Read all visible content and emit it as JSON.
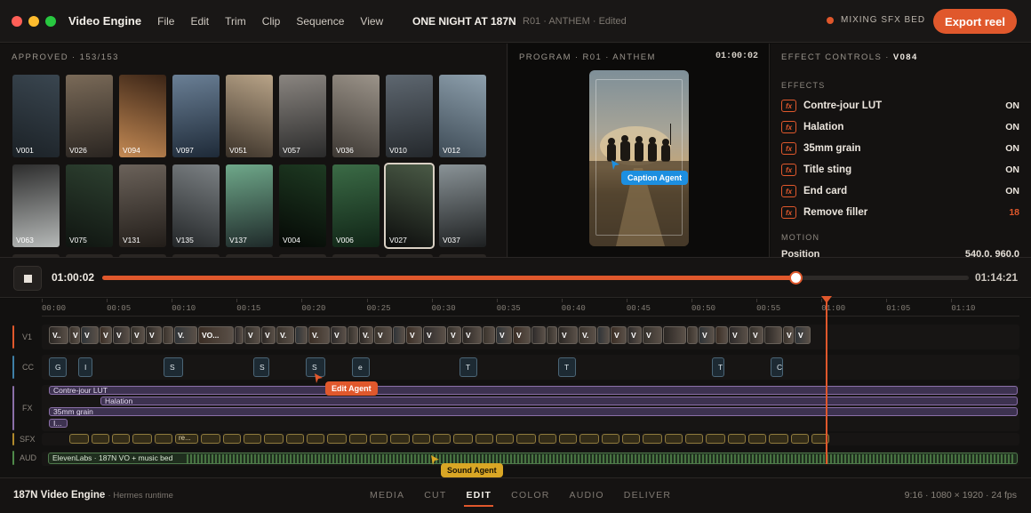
{
  "window": {
    "app_name": "Video Engine",
    "menu": [
      "File",
      "Edit",
      "Trim",
      "Clip",
      "Sequence",
      "View"
    ],
    "project_title": "ONE NIGHT AT 187N",
    "project_subtitle": "R01 · ANTHEM · Edited",
    "status": "MIXING SFX BED",
    "export_label": "Export reel"
  },
  "media": {
    "header": "APPROVED · 153/153",
    "thumbs": [
      "V001",
      "V026",
      "V094",
      "V097",
      "V051",
      "V057",
      "V036",
      "V010",
      "V012",
      "V063",
      "V075",
      "V131",
      "V135",
      "V137",
      "V004",
      "V006",
      "V027",
      "V037"
    ],
    "selected": "V027"
  },
  "program": {
    "header": "PROGRAM · R01 · ANTHEM",
    "timecode": "01:00:02",
    "agent": "Caption Agent"
  },
  "effects": {
    "header_prefix": "EFFECT CONTROLS · ",
    "clip": "V084",
    "section_effects": "EFFECTS",
    "badge": "fx",
    "items": [
      {
        "name": "Contre-jour LUT",
        "value": "ON"
      },
      {
        "name": "Halation",
        "value": "ON"
      },
      {
        "name": "35mm grain",
        "value": "ON"
      },
      {
        "name": "Title sting",
        "value": "ON"
      },
      {
        "name": "End card",
        "value": "ON"
      },
      {
        "name": "Remove filler",
        "value": "18"
      }
    ],
    "section_motion": "MOTION",
    "position_label": "Position",
    "position_value": "540.0, 960.0"
  },
  "transport": {
    "current": "01:00:02",
    "end": "01:14:21",
    "progress": 0.8
  },
  "timeline": {
    "ruler": [
      "00:00",
      "00:05",
      "00:10",
      "00:15",
      "00:20",
      "00:25",
      "00:30",
      "00:35",
      "00:40",
      "00:45",
      "00:50",
      "00:55",
      "01:00",
      "01:05",
      "01:10"
    ],
    "tracks": [
      "V1",
      "CC",
      "FX",
      "SFX",
      "AUD"
    ],
    "cc_clips": [
      "G",
      "I",
      "S",
      "S",
      "S",
      "e",
      "T",
      "T",
      "T",
      "C"
    ],
    "fx_clips": [
      "Contre-jour LUT",
      "Halation",
      "35mm grain",
      "I..."
    ],
    "sfx_label": "re...",
    "audio_label": "ElevenLabs · 187N VO + music bed",
    "agents": {
      "edit": "Edit Agent",
      "sound": "Sound Agent"
    }
  },
  "bottom": {
    "brand": "187N Video Engine",
    "runtime": "Hermes runtime",
    "tabs": [
      "MEDIA",
      "CUT",
      "EDIT",
      "COLOR",
      "AUDIO",
      "DELIVER"
    ],
    "active_tab": "EDIT",
    "format": "9:16 · 1080 × 1920 · 24 fps"
  },
  "colors": {
    "accent": "#e0582c",
    "caption_agent": "#1d8fe0",
    "edit_agent": "#e0582c",
    "sound_agent": "#d9a625"
  }
}
